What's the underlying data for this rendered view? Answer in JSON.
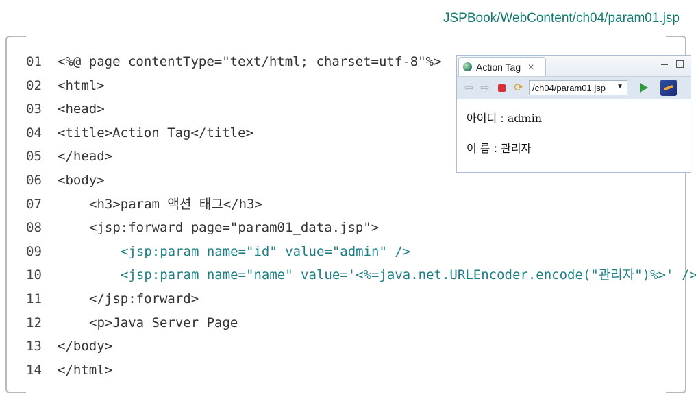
{
  "file_path": "JSPBook/WebContent/ch04/param01.jsp",
  "code_lines": [
    {
      "num": "01",
      "text": "<%@ page contentType=\"text/html; charset=utf-8\"%>",
      "indent": 0,
      "color": "dark"
    },
    {
      "num": "02",
      "text": "<html>",
      "indent": 0,
      "color": "dark"
    },
    {
      "num": "03",
      "text": "<head>",
      "indent": 0,
      "color": "dark"
    },
    {
      "num": "04",
      "text": "<title>Action Tag</title>",
      "indent": 0,
      "color": "dark"
    },
    {
      "num": "05",
      "text": "</head>",
      "indent": 0,
      "color": "dark"
    },
    {
      "num": "06",
      "text": "<body>",
      "indent": 0,
      "color": "dark"
    },
    {
      "num": "07",
      "text": "<h3>param 액션 태그</h3>",
      "indent": 1,
      "color": "dark"
    },
    {
      "num": "08",
      "text": "<jsp:forward page=\"param01_data.jsp\">",
      "indent": 1,
      "color": "dark"
    },
    {
      "num": "09",
      "text": "<jsp:param name=\"id\" value=\"admin\" />",
      "indent": 2,
      "color": "teal"
    },
    {
      "num": "10",
      "text": "<jsp:param name=\"name\" value='<%=java.net.URLEncoder.encode(\"관리자\")%>' />",
      "indent": 2,
      "color": "teal"
    },
    {
      "num": "11",
      "text": "</jsp:forward>",
      "indent": 1,
      "color": "dark"
    },
    {
      "num": "12",
      "text": "<p>Java Server Page",
      "indent": 1,
      "color": "dark"
    },
    {
      "num": "13",
      "text": "</body>",
      "indent": 0,
      "color": "dark"
    },
    {
      "num": "14",
      "text": "</html>",
      "indent": 0,
      "color": "dark"
    }
  ],
  "browser": {
    "tab_title": "Action Tag",
    "tab_close": "✕",
    "url": "/ch04/param01.jsp",
    "rows": [
      {
        "label": "아이디 : ",
        "value": "admin"
      },
      {
        "label": "이 름 : ",
        "value": "관리자"
      }
    ]
  },
  "colors": {
    "accent": "#127a70",
    "code_teal": "#1f7f86",
    "code_text": "#333333"
  }
}
